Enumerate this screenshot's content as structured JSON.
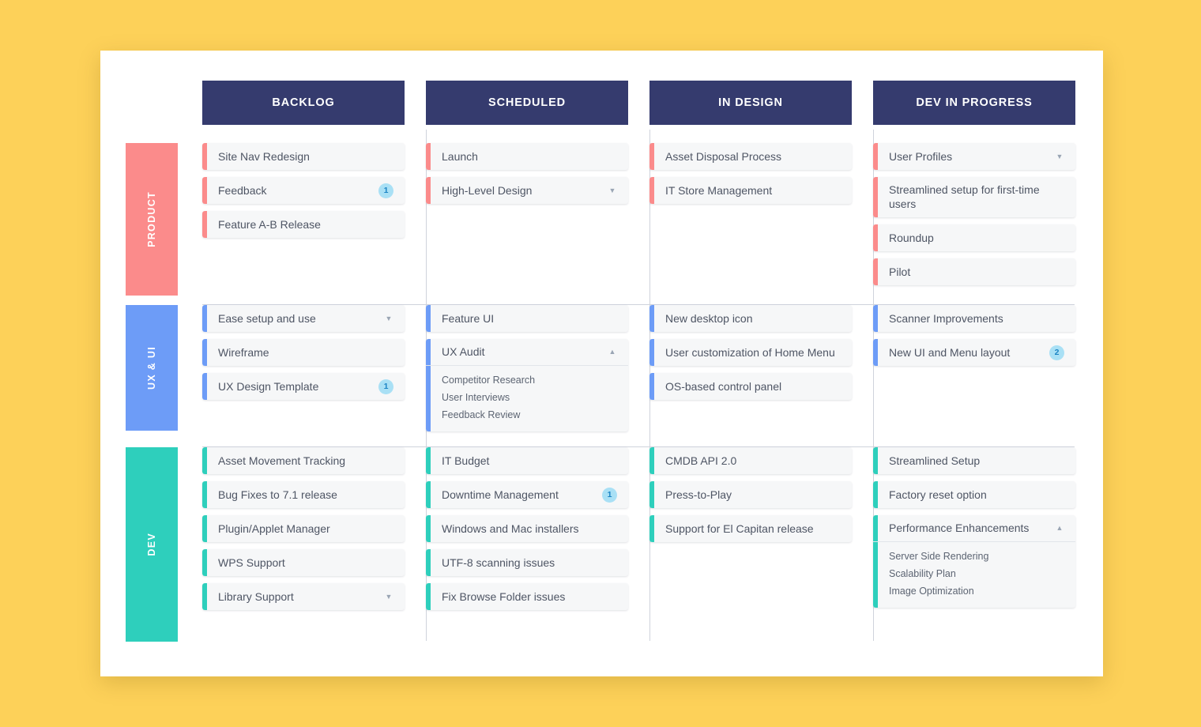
{
  "theme": {
    "page_background": "#fdd159",
    "board_background": "#ffffff",
    "header_background": "#353b6e",
    "header_text": "#ffffff",
    "card_background": "#f6f7f8",
    "card_text": "#4e5564",
    "badge_background": "#a9e0f5",
    "badge_text": "#1b84c4",
    "divider": "#cfd3dc",
    "accent_product": "#fb8b8b",
    "accent_ux": "#6d9cf7",
    "accent_dev": "#2ecfbc"
  },
  "columns": [
    {
      "id": "backlog",
      "label": "BACKLOG"
    },
    {
      "id": "scheduled",
      "label": "SCHEDULED"
    },
    {
      "id": "in-design",
      "label": "IN DESIGN"
    },
    {
      "id": "dev-in-progress",
      "label": "DEV IN PROGRESS"
    }
  ],
  "swimlanes": [
    {
      "id": "product",
      "label": "PRODUCT",
      "color": "#fb8b8b",
      "cells": [
        {
          "column": "backlog",
          "cards": [
            {
              "title": "Site Nav Redesign",
              "badge": null,
              "toggle": null
            },
            {
              "title": "Feedback",
              "badge": "1",
              "toggle": null
            },
            {
              "title": "Feature A-B Release",
              "badge": null,
              "toggle": null
            }
          ]
        },
        {
          "column": "scheduled",
          "cards": [
            {
              "title": "Launch",
              "badge": null,
              "toggle": null
            },
            {
              "title": "High-Level Design",
              "badge": null,
              "toggle": "collapsed"
            }
          ]
        },
        {
          "column": "in-design",
          "cards": [
            {
              "title": "Asset Disposal Process",
              "badge": null,
              "toggle": null
            },
            {
              "title": "IT Store Management",
              "badge": null,
              "toggle": null
            }
          ]
        },
        {
          "column": "dev-in-progress",
          "cards": [
            {
              "title": "User Profiles",
              "badge": null,
              "toggle": "collapsed"
            },
            {
              "title": "Streamlined setup for first-time users",
              "badge": null,
              "toggle": null
            },
            {
              "title": "Roundup",
              "badge": null,
              "toggle": null
            },
            {
              "title": "Pilot",
              "badge": null,
              "toggle": null
            }
          ]
        }
      ]
    },
    {
      "id": "ux-ui",
      "label": "UX & UI",
      "color": "#6d9cf7",
      "cells": [
        {
          "column": "backlog",
          "cards": [
            {
              "title": "Ease setup and use",
              "badge": null,
              "toggle": "collapsed"
            },
            {
              "title": "Wireframe",
              "badge": null,
              "toggle": null
            },
            {
              "title": "UX Design Template",
              "badge": "1",
              "toggle": null
            }
          ]
        },
        {
          "column": "scheduled",
          "cards": [
            {
              "title": "Feature UI",
              "badge": null,
              "toggle": null
            },
            {
              "title": "UX Audit",
              "badge": null,
              "toggle": "expanded",
              "subitems": [
                "Competitor Research",
                "User Interviews",
                "Feedback Review"
              ]
            }
          ]
        },
        {
          "column": "in-design",
          "cards": [
            {
              "title": "New desktop icon",
              "badge": null,
              "toggle": null
            },
            {
              "title": "User customization of Home Menu",
              "badge": null,
              "toggle": null
            },
            {
              "title": "OS-based control panel",
              "badge": null,
              "toggle": null
            }
          ]
        },
        {
          "column": "dev-in-progress",
          "cards": [
            {
              "title": "Scanner Improvements",
              "badge": null,
              "toggle": null
            },
            {
              "title": "New UI and Menu layout",
              "badge": "2",
              "toggle": null
            }
          ]
        }
      ]
    },
    {
      "id": "dev",
      "label": "DEV",
      "color": "#2ecfbc",
      "cells": [
        {
          "column": "backlog",
          "cards": [
            {
              "title": "Asset Movement Tracking",
              "badge": null,
              "toggle": null
            },
            {
              "title": "Bug Fixes to 7.1 release",
              "badge": null,
              "toggle": null
            },
            {
              "title": "Plugin/Applet Manager",
              "badge": null,
              "toggle": null
            },
            {
              "title": "WPS Support",
              "badge": null,
              "toggle": null
            },
            {
              "title": "Library Support",
              "badge": null,
              "toggle": "collapsed"
            }
          ]
        },
        {
          "column": "scheduled",
          "cards": [
            {
              "title": "IT Budget",
              "badge": null,
              "toggle": null
            },
            {
              "title": "Downtime Management",
              "badge": "1",
              "toggle": null
            },
            {
              "title": "Windows and Mac installers",
              "badge": null,
              "toggle": null
            },
            {
              "title": "UTF-8 scanning issues",
              "badge": null,
              "toggle": null
            },
            {
              "title": "Fix Browse Folder issues",
              "badge": null,
              "toggle": null
            }
          ]
        },
        {
          "column": "in-design",
          "cards": [
            {
              "title": "CMDB API 2.0",
              "badge": null,
              "toggle": null
            },
            {
              "title": "Press-to-Play",
              "badge": null,
              "toggle": null
            },
            {
              "title": "Support for El Capitan release",
              "badge": null,
              "toggle": null
            }
          ]
        },
        {
          "column": "dev-in-progress",
          "cards": [
            {
              "title": "Streamlined Setup",
              "badge": null,
              "toggle": null
            },
            {
              "title": "Factory reset option",
              "badge": null,
              "toggle": null
            },
            {
              "title": "Performance Enhancements",
              "badge": null,
              "toggle": "expanded",
              "subitems": [
                "Server Side Rendering",
                "Scalability Plan",
                "Image Optimization"
              ]
            }
          ]
        }
      ]
    }
  ],
  "icons": {
    "chevron_down": "▼",
    "chevron_up": "▲"
  }
}
